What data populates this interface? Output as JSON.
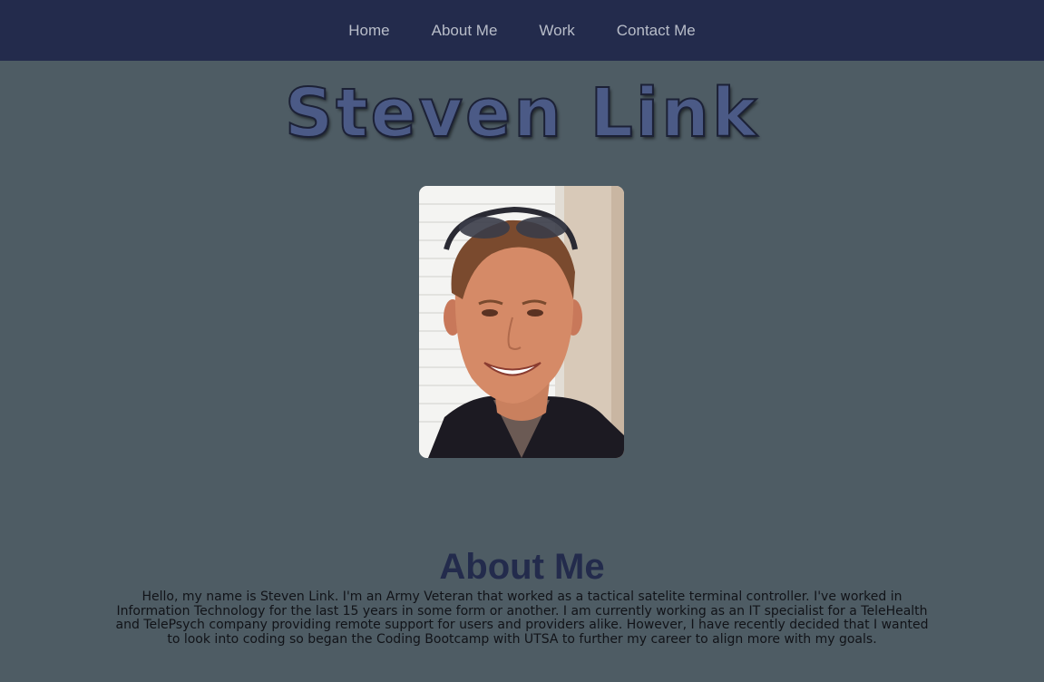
{
  "nav": {
    "items": [
      {
        "label": "Home"
      },
      {
        "label": "About Me"
      },
      {
        "label": "Work"
      },
      {
        "label": "Contact Me"
      }
    ]
  },
  "hero": {
    "name": "Steven Link"
  },
  "about": {
    "heading": "About Me",
    "body": "Hello, my name is Steven Link. I'm an Army Veteran that worked as a tactical satelite terminal controller. I've worked in Information Technology for the last 15 years in some form or another. I am currently working as an IT specialist for a TeleHealth and TelePsych company providing remote support for users and providers alike. However, I have recently decided that I wanted to look into coding so began the Coding Bootcamp with UTSA to further my career to align more with my goals."
  },
  "colors": {
    "navbar": "#232b4c",
    "page_background": "#4e5c64",
    "nav_text": "#b8bdc9",
    "title_fill": "#4b5a86",
    "heading": "#232b4c"
  }
}
